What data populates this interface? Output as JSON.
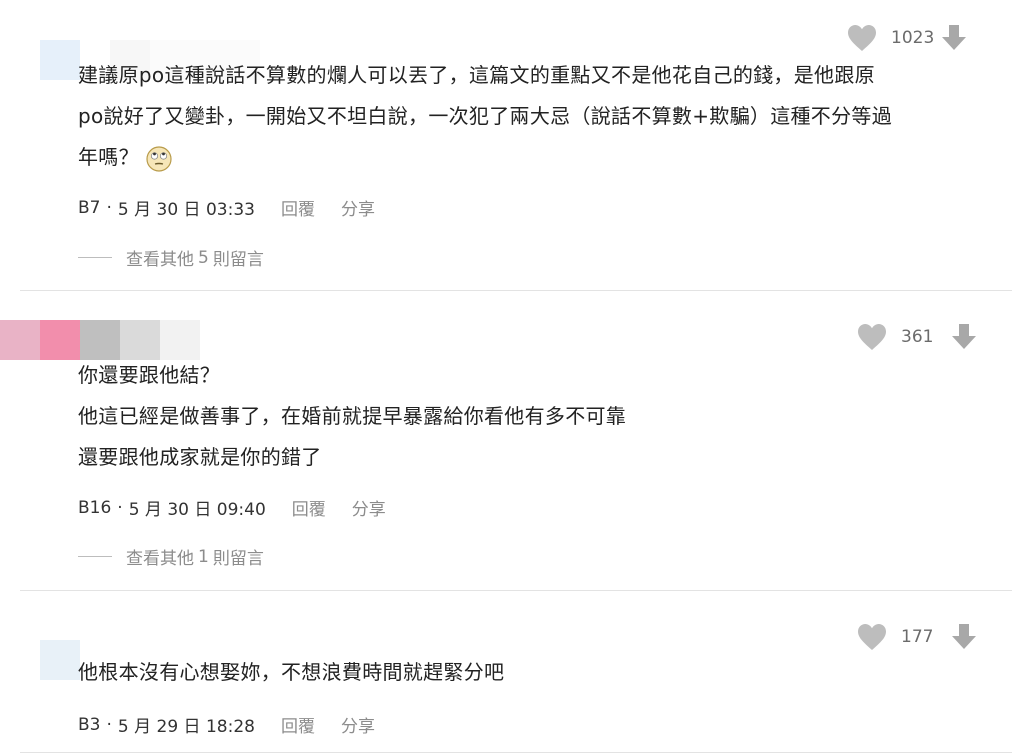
{
  "comments": [
    {
      "likes": "1023",
      "lines": [
        "建議原po這種說話不算數的爛人可以丟了，這篇文的重點又不是他花自己的錢，是他跟原",
        "po說好了又變卦，一開始又不坦白說，一次犯了兩大忌（說話不算數+欺騙）這種不分等過",
        "年嗎？"
      ],
      "emoji": "rolling-eyes-emoji",
      "floor": "B7",
      "sep": "·",
      "date": "5 月 30 日 03:33",
      "reply": "回覆",
      "share": "分享",
      "more_prefix": "查看其他",
      "more_count": "5",
      "more_suffix": "則留言"
    },
    {
      "likes": "361",
      "lines": [
        "你還要跟他結？",
        "他這已經是做善事了，在婚前就提早暴露給你看他有多不可靠",
        "還要跟他成家就是你的錯了"
      ],
      "floor": "B16",
      "sep": "·",
      "date": "5 月 30 日 09:40",
      "reply": "回覆",
      "share": "分享",
      "more_prefix": "查看其他",
      "more_count": "1",
      "more_suffix": "則留言"
    },
    {
      "likes": "177",
      "lines": [
        "他根本沒有心想娶妳，不想浪費時間就趕緊分吧"
      ],
      "floor": "B3",
      "sep": "·",
      "date": "5 月 29 日 18:28",
      "reply": "回覆",
      "share": "分享"
    }
  ],
  "colors": {
    "heart": "#bdbdbd",
    "down": "#a8a8a8",
    "meta_action": "#8c8c8c",
    "divider": "#e3e3e3"
  },
  "icons": [
    "heart-icon",
    "downvote-icon",
    "rolling-eyes-emoji"
  ]
}
